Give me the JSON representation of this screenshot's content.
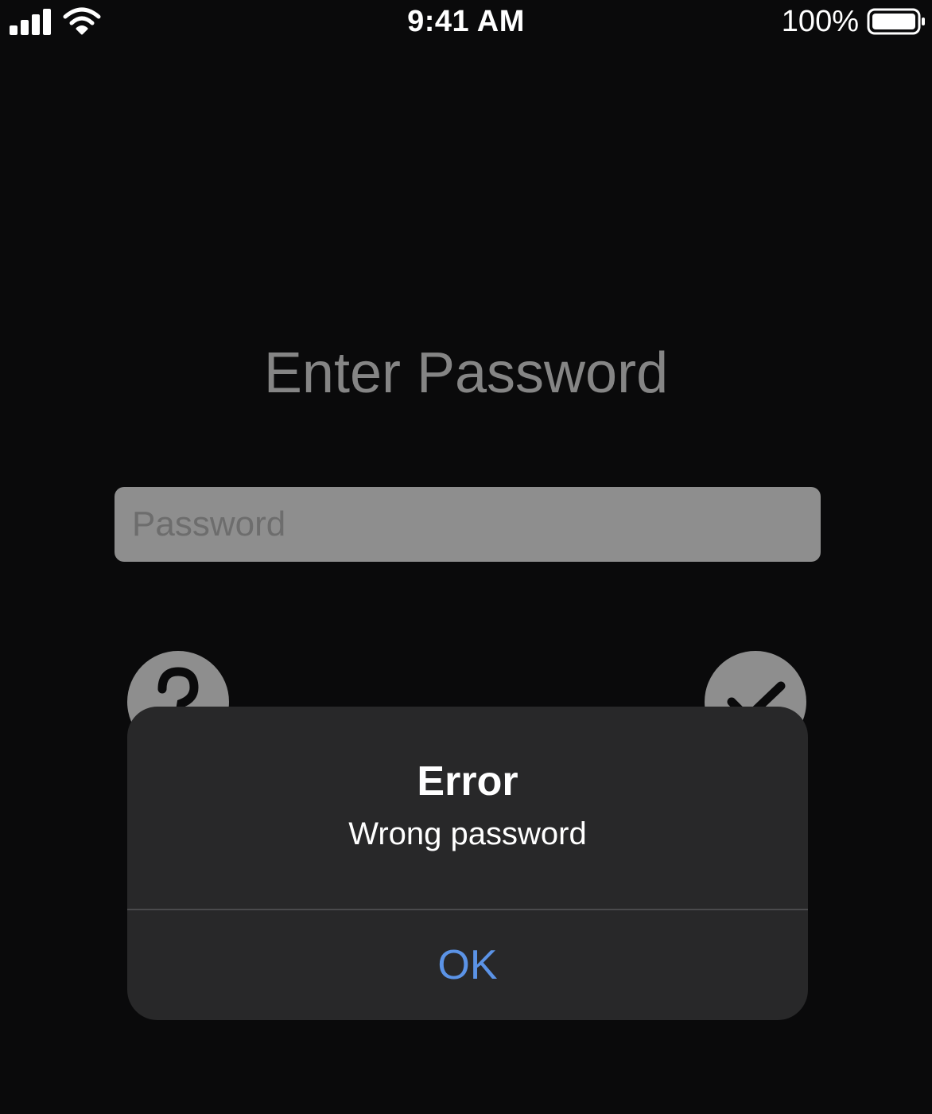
{
  "status_bar": {
    "time": "9:41 AM",
    "battery_percent": "100%",
    "icons": [
      "signal-icon",
      "wifi-icon",
      "battery-icon"
    ]
  },
  "screen": {
    "title": "Enter Password",
    "password_input": {
      "value": "",
      "placeholder": "Password"
    },
    "buttons": [
      {
        "icon": "question-icon"
      },
      {
        "icon": "checkmark-icon"
      }
    ]
  },
  "alert": {
    "title": "Error",
    "message": "Wrong password",
    "ok_label": "OK"
  },
  "colors": {
    "background": "#0a0a0b",
    "alert_background": "#282829",
    "accent": "#5b93e6",
    "input_background": "#8e8e8e"
  }
}
